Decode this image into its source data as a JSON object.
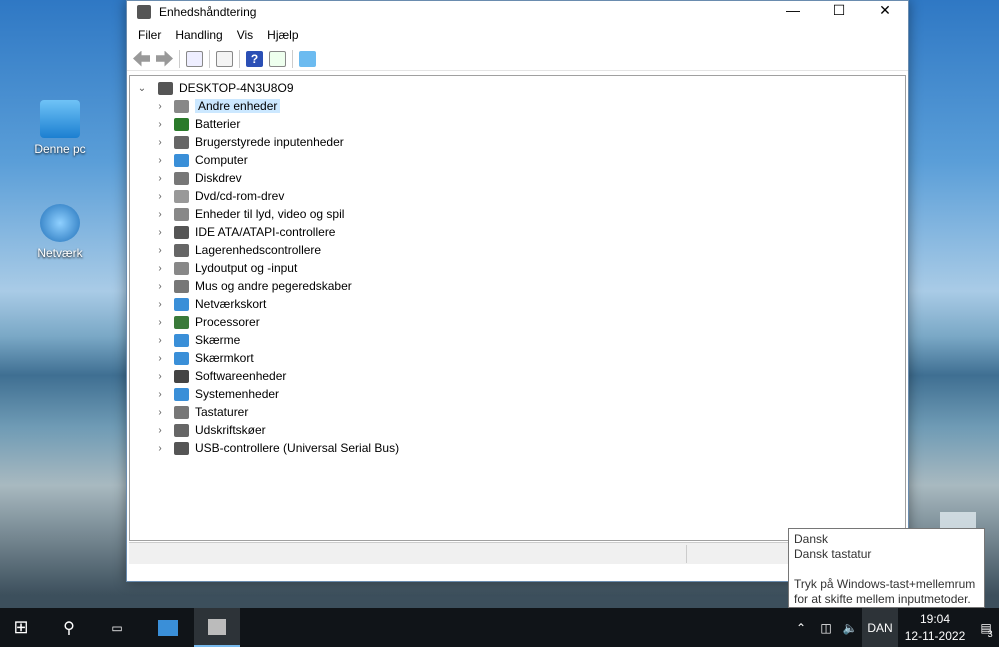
{
  "desktop": {
    "icons": [
      {
        "label": "Denne pc"
      },
      {
        "label": "Netværk"
      }
    ]
  },
  "window": {
    "title": "Enhedshåndtering",
    "controls": [
      "minimize",
      "maximize",
      "close"
    ],
    "menu": [
      "Filer",
      "Handling",
      "Vis",
      "Hjælp"
    ],
    "toolbar": [
      "back-icon",
      "forward-icon",
      "show-hide-console-tree-icon",
      "properties-icon",
      "help-icon",
      "run-icon",
      "scan-hardware-icon"
    ],
    "tree": {
      "root": "DESKTOP-4N3U8O9",
      "items": [
        "Andre enheder",
        "Batterier",
        "Brugerstyrede inputenheder",
        "Computer",
        "Diskdrev",
        "Dvd/cd-rom-drev",
        "Enheder til lyd, video og spil",
        "IDE ATA/ATAPI-controllere",
        "Lagerenhedscontrollere",
        "Lydoutput og -input",
        "Mus og andre pegeredskaber",
        "Netværkskort",
        "Processorer",
        "Skærme",
        "Skærmkort",
        "Softwareenheder",
        "Systemenheder",
        "Tastaturer",
        "Udskriftskøer",
        "USB-controllere (Universal Serial Bus)"
      ],
      "item_colors": [
        "#888",
        "#2a7a2a",
        "#666",
        "#3a8fd8",
        "#777",
        "#999",
        "#888",
        "#555",
        "#666",
        "#888",
        "#777",
        "#3a8fd8",
        "#3a7a3a",
        "#3a8fd8",
        "#3a8fd8",
        "#444",
        "#3a8fd8",
        "#777",
        "#666",
        "#555"
      ]
    }
  },
  "tooltip": {
    "line1": "Dansk",
    "line2": "Dansk tastatur",
    "line3": "Tryk på Windows-tast+mellemrum",
    "line4": "for at skifte mellem inputmetoder."
  },
  "taskbar": {
    "language": "DAN",
    "time": "19:04",
    "date": "12-11-2022",
    "notifications": "3"
  }
}
